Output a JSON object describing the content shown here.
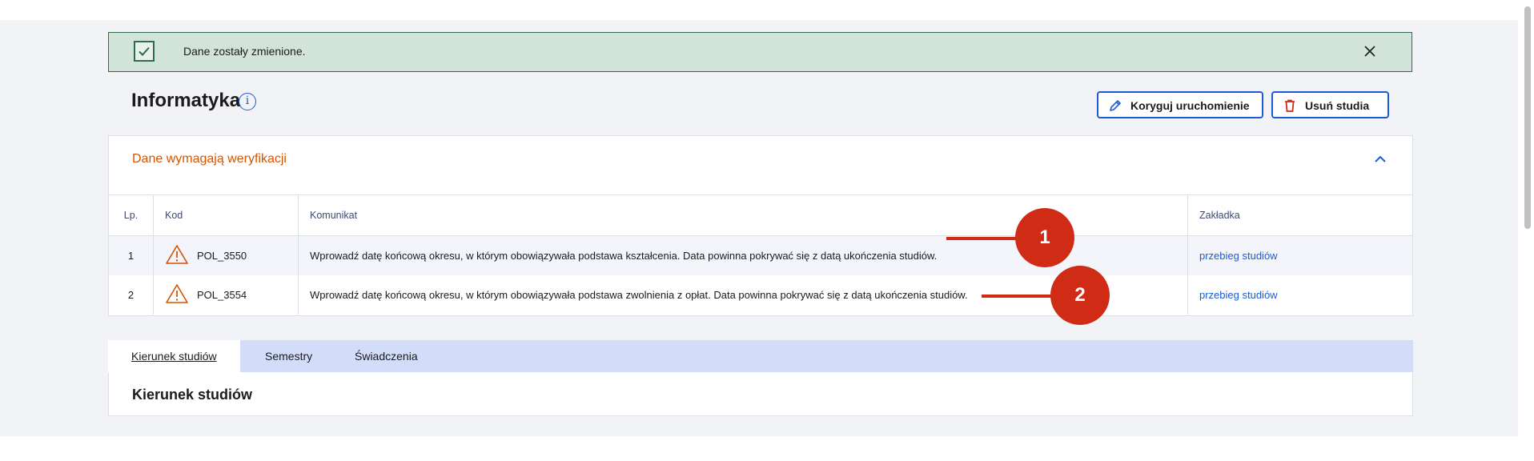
{
  "alert": {
    "text": "Dane zostały zmienione.",
    "close_icon": "close-icon",
    "accent": "#2f6b48"
  },
  "page": {
    "title": "Informatyka"
  },
  "actions": {
    "edit_label": "Koryguj uruchomienie",
    "delete_label": "Usuń studia"
  },
  "verification": {
    "title": "Dane wymagają weryfikacji",
    "columns": [
      "Lp.",
      "Kod",
      "Komunikat",
      "Zakładka"
    ],
    "rows": [
      {
        "lp": "1",
        "code": "POL_3550",
        "message": "Wprowadź datę końcową okresu, w którym obowiązywała podstawa kształcenia. Data powinna pokrywać się z datą ukończenia studiów.",
        "tab": "przebieg studiów"
      },
      {
        "lp": "2",
        "code": "POL_3554",
        "message": "Wprowadź datę końcową okresu, w którym obowiązywała podstawa zwolnienia z opłat. Data powinna pokrywać się z datą ukończenia studiów.",
        "tab": "przebieg studiów"
      }
    ]
  },
  "markers": [
    "1",
    "2"
  ],
  "tabs": [
    "Kierunek studiów",
    "Semestry",
    "Świadczenia"
  ],
  "section": {
    "title": "Kierunek studiów"
  },
  "colors": {
    "link": "#1a5bd6",
    "warning": "#d35400",
    "marker": "#d02b14"
  }
}
